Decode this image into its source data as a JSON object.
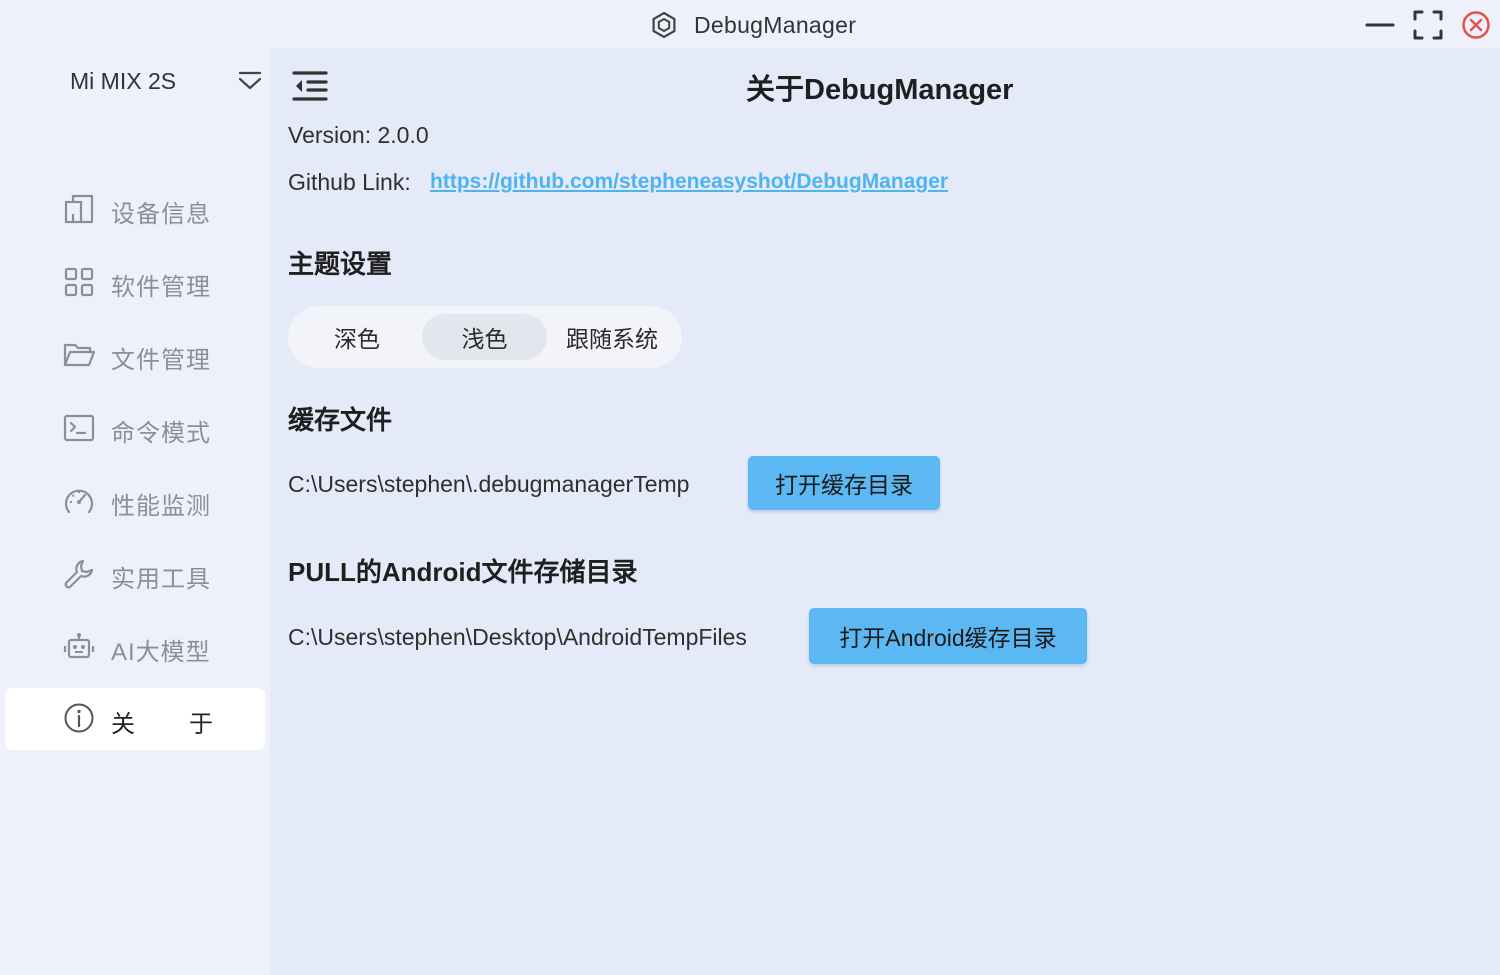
{
  "window": {
    "title": "DebugManager",
    "icons": {
      "app": "hexagon-logo-icon",
      "minimize": "minimize-icon",
      "maximize": "maximize-icon",
      "close": "close-icon"
    }
  },
  "sidebar": {
    "device_name": "Mi MIX 2S",
    "device_toggle_icon": "chevron-down-icon",
    "items": [
      {
        "label": "设备信息",
        "icon": "device-info-icon",
        "active": false
      },
      {
        "label": "软件管理",
        "icon": "apps-grid-icon",
        "active": false
      },
      {
        "label": "文件管理",
        "icon": "folder-icon",
        "active": false
      },
      {
        "label": "命令模式",
        "icon": "terminal-icon",
        "active": false
      },
      {
        "label": "性能监测",
        "icon": "gauge-icon",
        "active": false
      },
      {
        "label": "实用工具",
        "icon": "wrench-icon",
        "active": false
      },
      {
        "label": "AI大模型",
        "icon": "robot-icon",
        "active": false
      },
      {
        "label_part1": "关",
        "label_part2": "于",
        "icon": "info-icon",
        "active": true
      }
    ]
  },
  "main": {
    "menu_icon": "collapse-menu-icon",
    "title": "关于DebugManager",
    "version_text": "Version: 2.0.0",
    "github_label": "Github Link:",
    "github_url": "https://github.com/stepheneasyshot/DebugManager",
    "theme": {
      "heading": "主题设置",
      "options": [
        "深色",
        "浅色",
        "跟随系统"
      ],
      "selected": "浅色"
    },
    "cache": {
      "heading": "缓存文件",
      "path": "C:\\Users\\stephen\\.debugmanagerTemp",
      "button": "打开缓存目录"
    },
    "pull": {
      "heading": "PULL的Android文件存储目录",
      "path": "C:\\Users\\stephen\\Desktop\\AndroidTempFiles",
      "button": "打开Android缓存目录"
    }
  },
  "colors": {
    "accent": "#5cb8f2",
    "link": "#4fb3f0",
    "close": "#e5534b",
    "background": "#e4eaf8",
    "sidebar": "#eef1fb"
  }
}
